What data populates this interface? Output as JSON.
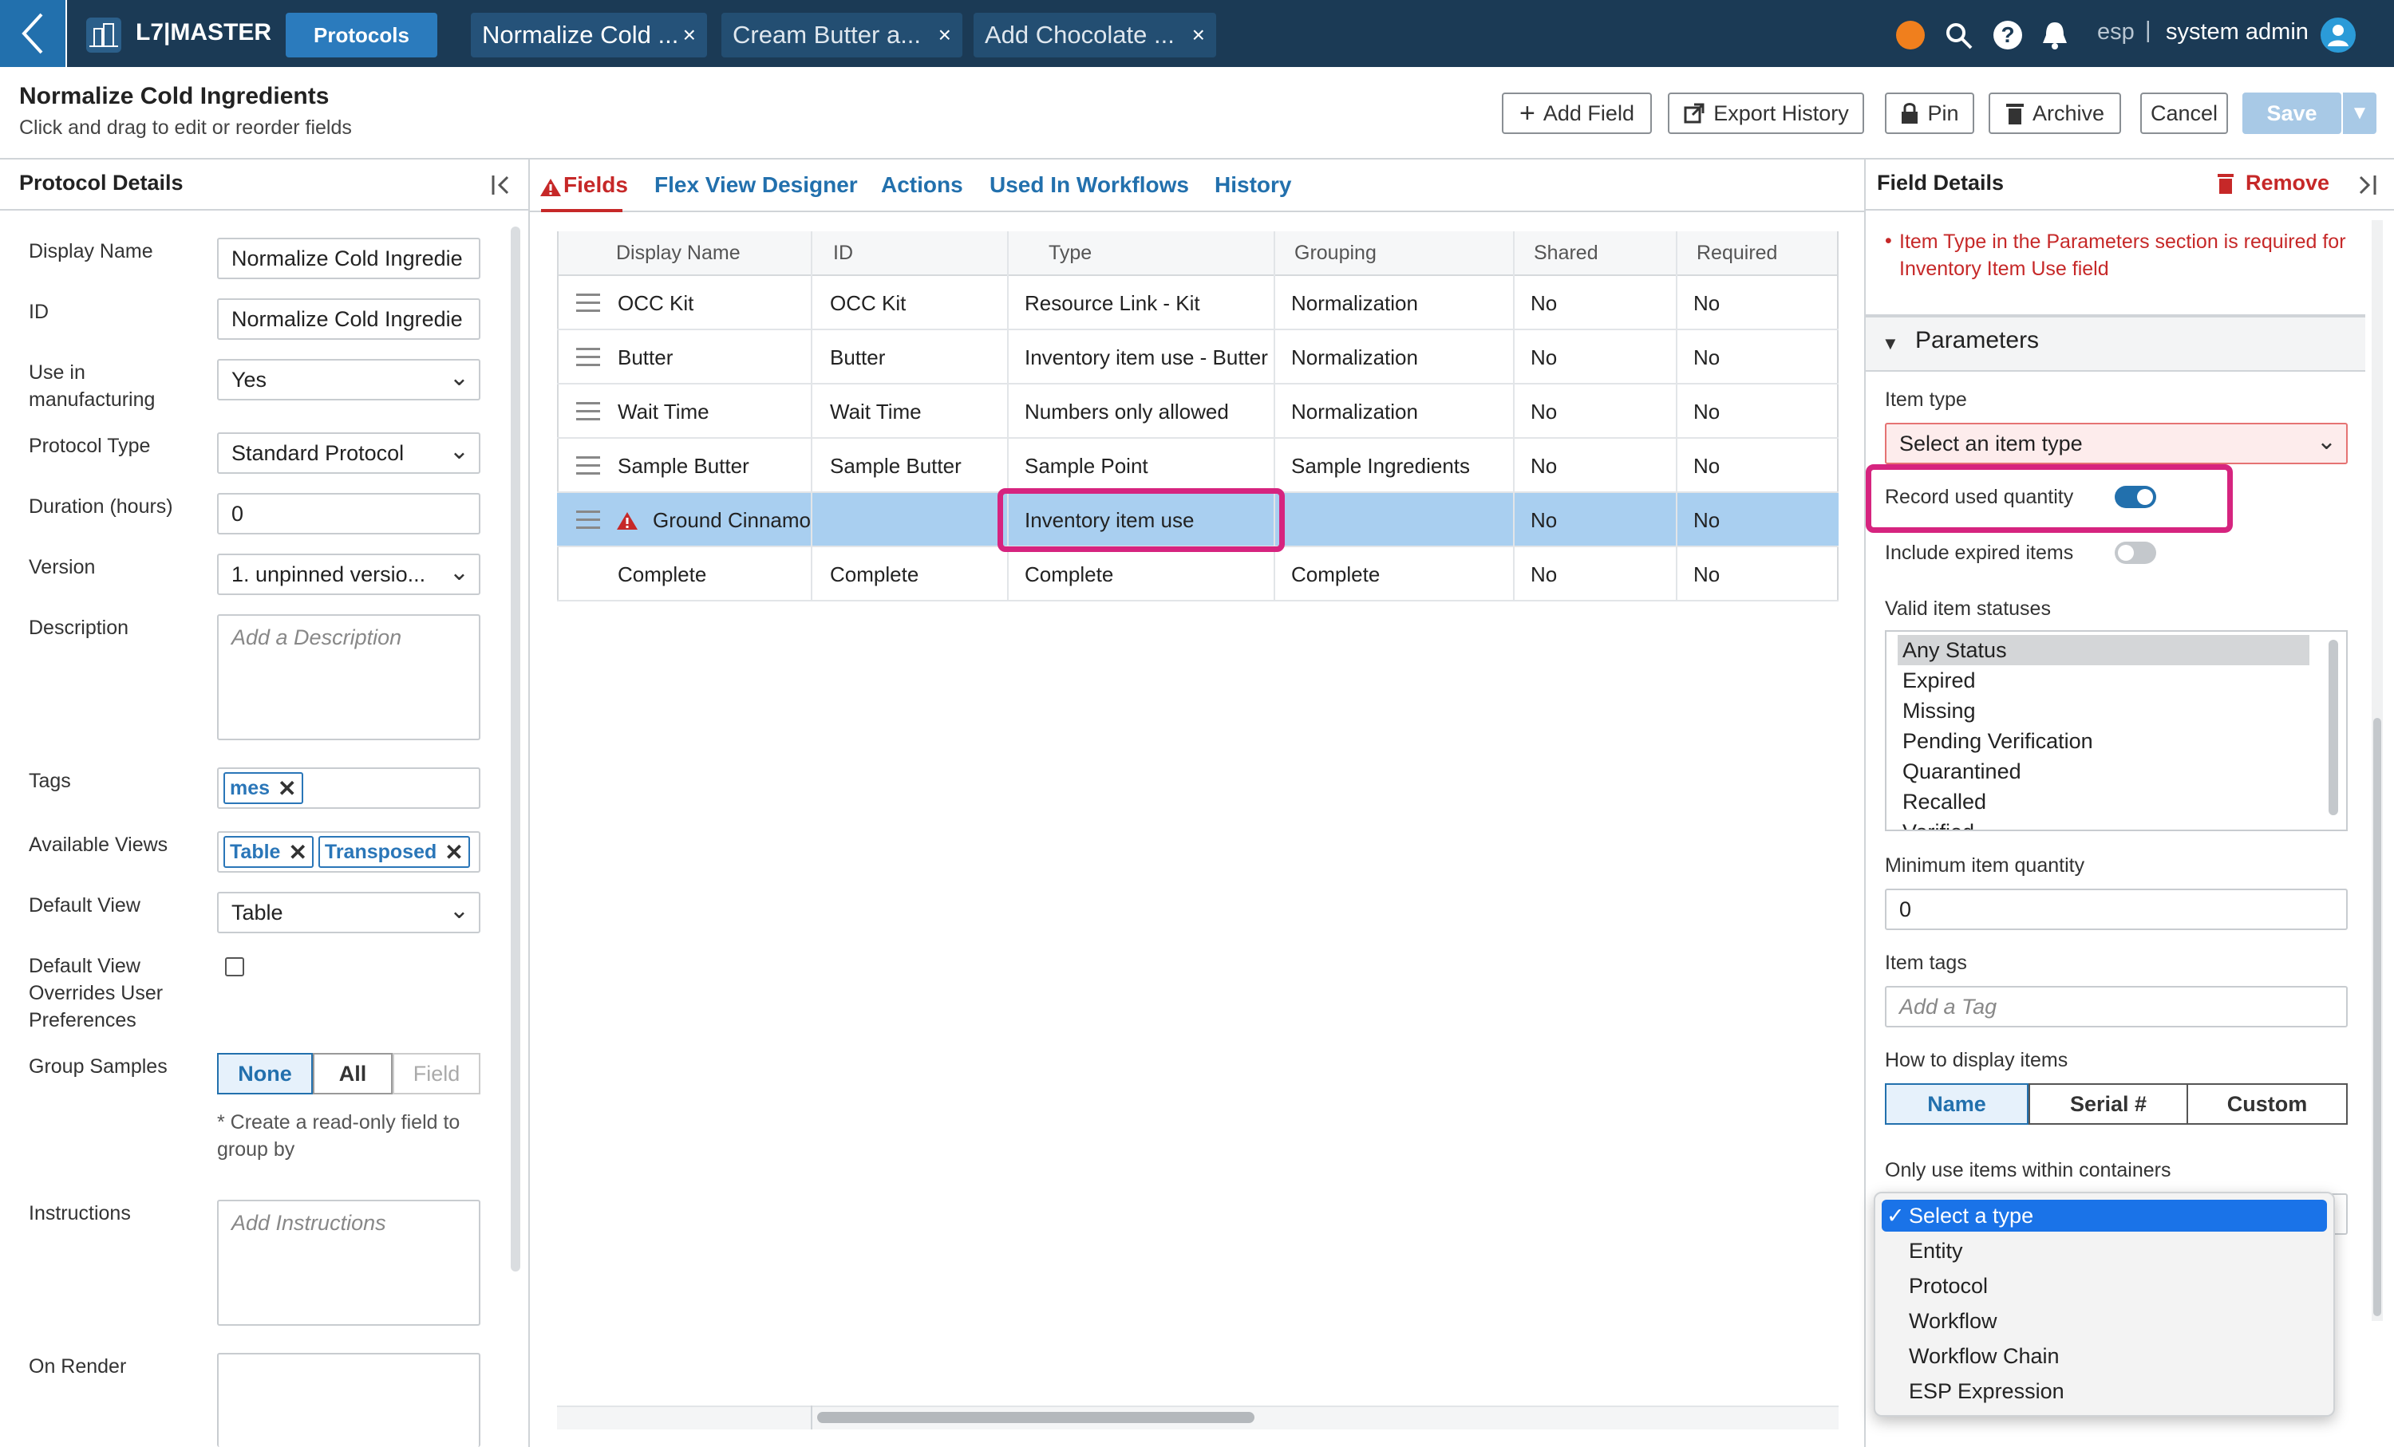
{
  "topbar": {
    "app_name": "L7|MASTER",
    "protocols_label": "Protocols",
    "tabs": [
      {
        "label": "Normalize Cold ..."
      },
      {
        "label": "Cream Butter a..."
      },
      {
        "label": "Add Chocolate ..."
      }
    ],
    "language": "esp",
    "separator": "|",
    "user": "system admin",
    "close_glyph": "×"
  },
  "header": {
    "title": "Normalize Cold Ingredients",
    "subtitle": "Click and drag to edit or reorder fields",
    "buttons": {
      "add_field": "Add Field",
      "export_history": "Export History",
      "pin": "Pin",
      "archive": "Archive",
      "cancel": "Cancel",
      "save": "Save"
    }
  },
  "left": {
    "title": "Protocol Details",
    "display_name_label": "Display Name",
    "display_name_value": "Normalize Cold Ingredie",
    "id_label": "ID",
    "id_value": "Normalize Cold Ingredie",
    "use_in_mfg_label": "Use in manufacturing",
    "use_in_mfg_value": "Yes",
    "protocol_type_label": "Protocol Type",
    "protocol_type_value": "Standard Protocol",
    "duration_label": "Duration (hours)",
    "duration_value": "0",
    "version_label": "Version",
    "version_value": "1. unpinned versio...",
    "description_label": "Description",
    "description_placeholder": "Add a Description",
    "tags_label": "Tags",
    "tags": [
      "mes"
    ],
    "available_views_label": "Available Views",
    "available_views": [
      "Table",
      "Transposed"
    ],
    "default_view_label": "Default View",
    "default_view_value": "Table",
    "default_view_overrides_label": "Default View Overrides User Preferences",
    "group_samples_label": "Group Samples",
    "group_samples_options": [
      "None",
      "All",
      "Field"
    ],
    "group_note": "* Create a read-only field to group by",
    "instructions_label": "Instructions",
    "instructions_placeholder": "Add Instructions",
    "on_render_label": "On Render",
    "chip_remove": "✕"
  },
  "middle": {
    "tabs": [
      "Fields",
      "Flex View Designer",
      "Actions",
      "Used In Workflows",
      "History"
    ],
    "columns": [
      "Display Name",
      "ID",
      "Type",
      "Grouping",
      "Shared",
      "Required"
    ],
    "rows": [
      {
        "display_name": "OCC Kit",
        "id": "OCC Kit",
        "type": "Resource Link - Kit",
        "grouping": "Normalization",
        "shared": "No",
        "required": "No"
      },
      {
        "display_name": "Butter",
        "id": "Butter",
        "type": "Inventory item use - Butter",
        "grouping": "Normalization",
        "shared": "No",
        "required": "No"
      },
      {
        "display_name": "Wait Time",
        "id": "Wait Time",
        "type": "Numbers only allowed",
        "grouping": "Normalization",
        "shared": "No",
        "required": "No"
      },
      {
        "display_name": "Sample Butter",
        "id": "Sample Butter",
        "type": "Sample Point",
        "grouping": "Sample Ingredients",
        "shared": "No",
        "required": "No"
      },
      {
        "display_name": "Ground Cinnamon",
        "id": "",
        "type": "Inventory item use",
        "grouping": "",
        "shared": "No",
        "required": "No"
      },
      {
        "display_name": "Complete",
        "id": "Complete",
        "type": "Complete",
        "grouping": "Complete",
        "shared": "No",
        "required": "No"
      }
    ]
  },
  "right": {
    "title": "Field Details",
    "remove_label": "Remove",
    "error_text": "Item Type in the Parameters section is required for Inventory Item Use field",
    "parameters_label": "Parameters",
    "item_type_label": "Item type",
    "item_type_placeholder": "Select an item type",
    "record_used_quantity_label": "Record used quantity",
    "record_used_quantity_on": true,
    "include_expired_label": "Include expired items",
    "include_expired_on": false,
    "valid_statuses_label": "Valid item statuses",
    "valid_statuses": [
      "Any Status",
      "Expired",
      "Missing",
      "Pending Verification",
      "Quarantined",
      "Recalled",
      "Verified"
    ],
    "min_qty_label": "Minimum item quantity",
    "min_qty_value": "0",
    "item_tags_label": "Item tags",
    "item_tags_placeholder": "Add a Tag",
    "display_items_label": "How to display items",
    "display_items_options": [
      "Name",
      "Serial #",
      "Custom"
    ],
    "containers_label": "Only use items within containers",
    "dropdown_options": [
      "Select a type",
      "Entity",
      "Protocol",
      "Workflow",
      "Workflow Chain",
      "ESP Expression"
    ],
    "dropdown_selected": "Select a type"
  },
  "colors": {
    "nav_bg": "#1b3a55",
    "accent": "#2270ad",
    "highlight": "#d6247f",
    "selected_row": "#a9cff0",
    "error": "#c62828",
    "notification": "#f07f1d"
  }
}
